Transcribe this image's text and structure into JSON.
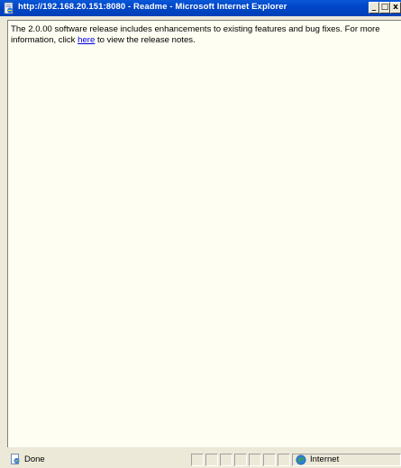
{
  "window": {
    "title": "http://192.168.20.151:8080 - Readme - Microsoft Internet Explorer"
  },
  "titlebar_buttons": {
    "minimize": "_",
    "maximize": "□",
    "close": "x"
  },
  "content": {
    "text_before_link": "The 2.0.00 software release includes enhancements to existing features and bug fixes. For more information, click ",
    "link_text": "here",
    "text_after_link": " to view the release notes."
  },
  "statusbar": {
    "status": "Done",
    "zone": "Internet"
  },
  "icons": {
    "title": "ie-page-icon",
    "status": "page-done-icon",
    "zone": "globe-icon"
  },
  "colors": {
    "titlebar": "#0046c8",
    "content_bg": "#fefef2",
    "link": "#0000ee"
  }
}
